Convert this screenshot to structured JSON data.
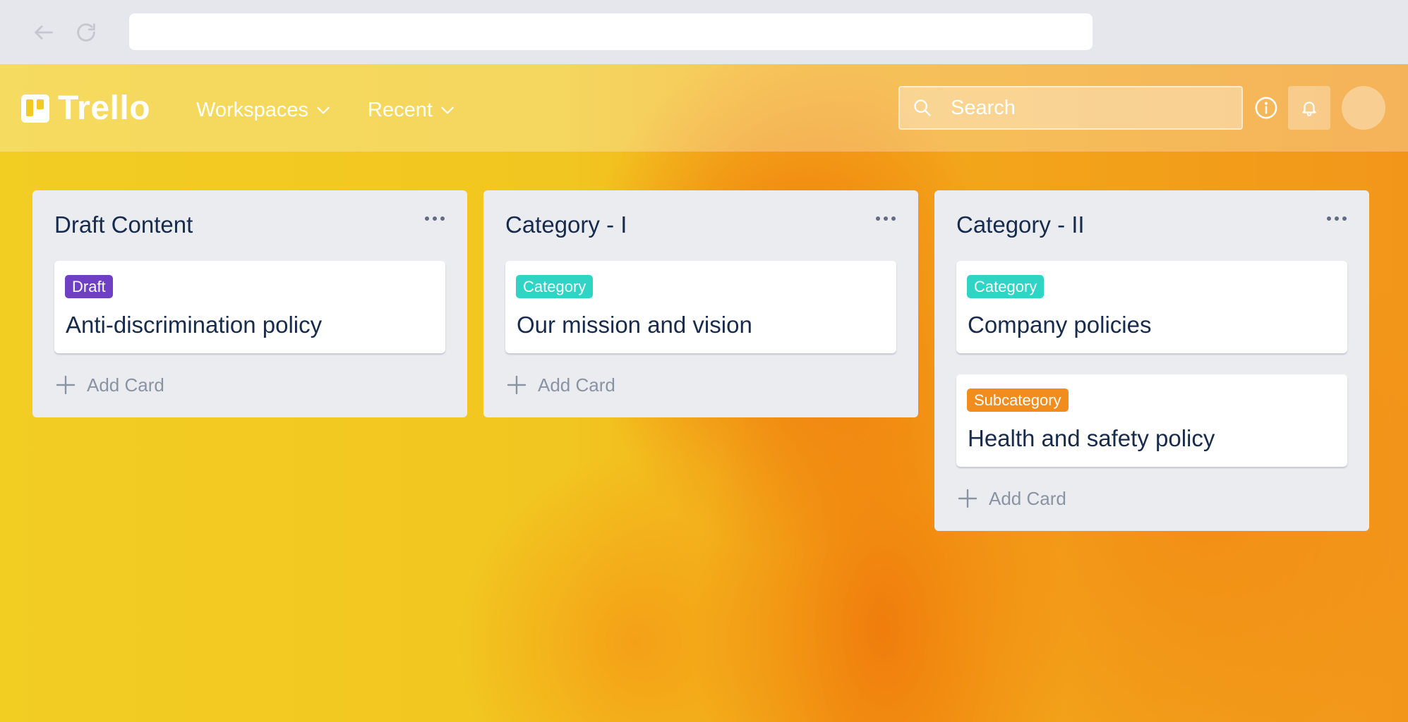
{
  "header": {
    "logo_text": "Trello",
    "menus": [
      {
        "label": "Workspaces"
      },
      {
        "label": "Recent"
      }
    ],
    "search": {
      "placeholder": "Search"
    }
  },
  "lists": [
    {
      "title": "Draft Content",
      "cards": [
        {
          "label": "Draft",
          "label_color": "#6f3fc4",
          "title": "Anti-discrimination policy"
        }
      ],
      "add_label": "Add Card"
    },
    {
      "title": "Category - I",
      "cards": [
        {
          "label": "Category",
          "label_color": "#2fd4c5",
          "title": "Our mission and vision"
        }
      ],
      "add_label": "Add Card"
    },
    {
      "title": "Category - II",
      "cards": [
        {
          "label": "Category",
          "label_color": "#2fd4c5",
          "title": "Company policies"
        },
        {
          "label": "Subcategory",
          "label_color": "#f28c1c",
          "title": "Health and safety policy"
        }
      ],
      "add_label": "Add Card"
    }
  ],
  "colors": {
    "list_bg": "#ebecf0",
    "text": "#172b4d",
    "muted": "#8993a4"
  }
}
